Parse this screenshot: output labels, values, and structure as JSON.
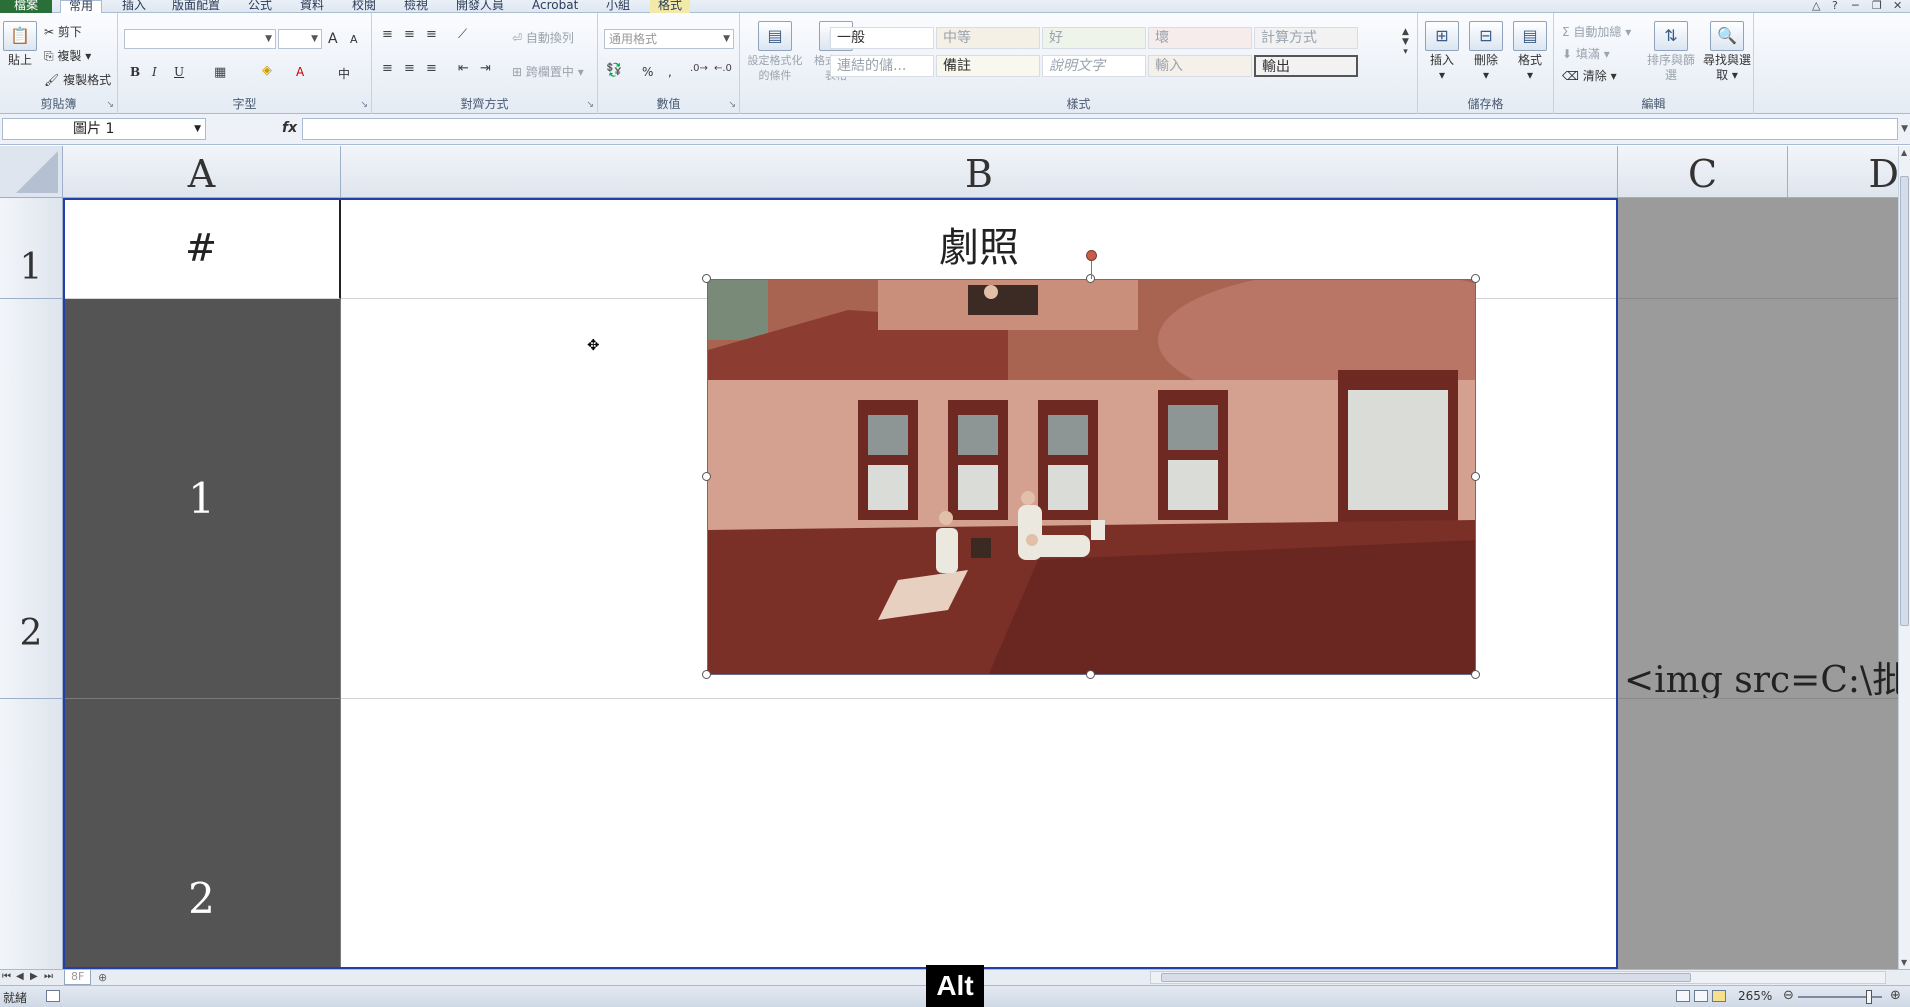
{
  "ribbon_tabs": [
    "檔案",
    "常用",
    "插入",
    "版面配置",
    "公式",
    "資料",
    "校閱",
    "檢視",
    "開發人員",
    "Acrobat",
    "小組",
    "格式"
  ],
  "clipboard": {
    "paste": "貼上",
    "cut": "剪下",
    "copy": "複製",
    "format_painter": "複製格式",
    "label": "剪貼簿"
  },
  "font": {
    "label": "字型",
    "bold": "B",
    "italic": "I",
    "underline": "U",
    "grow": "A",
    "shrink": "A",
    "color": "A",
    "phonetic": "中"
  },
  "alignment": {
    "label": "對齊方式",
    "wrap": "自動換列",
    "merge": "跨欄置中"
  },
  "number": {
    "label": "數值",
    "format": "通用格式",
    "percent": "%",
    "comma": ","
  },
  "styles": {
    "label": "樣式",
    "conditional": "設定格式化的條件",
    "as_table": "格式化為表格",
    "cells": [
      {
        "text": "一般",
        "bg": "#ffffff",
        "color": "#333333"
      },
      {
        "text": "中等",
        "bg": "#f5f0e6",
        "color": "#9aa3ae"
      },
      {
        "text": "好",
        "bg": "#eef4ea",
        "color": "#9aa3ae"
      },
      {
        "text": "壞",
        "bg": "#f6eceb",
        "color": "#9aa3ae"
      },
      {
        "text": "計算方式",
        "bg": "#f2f2f2",
        "color": "#9aa3ae"
      },
      {
        "text": "連結的儲...",
        "bg": "#ffffff",
        "color": "#9aa3ae"
      },
      {
        "text": "備註",
        "bg": "#f8f8ee",
        "color": "#333333"
      },
      {
        "text": "說明文字",
        "bg": "#ffffff",
        "color": "#9aa3ae"
      },
      {
        "text": "輸入",
        "bg": "#f5f0ea",
        "color": "#9aa3ae"
      },
      {
        "text": "輸出",
        "bg": "#f2f2f2",
        "color": "#333333"
      }
    ]
  },
  "cells_group": {
    "label": "儲存格",
    "insert": "插入",
    "delete": "刪除",
    "format": "格式"
  },
  "editing": {
    "label": "編輯",
    "autosum": "自動加總",
    "fill": "填滿",
    "clear": "清除",
    "sort": "排序與篩選",
    "find": "尋找與選取"
  },
  "name_box": "圖片 1",
  "fx": "fx",
  "columns": [
    "A",
    "B",
    "C",
    "D"
  ],
  "rows": [
    "1",
    "2"
  ],
  "cells": {
    "a1": "#",
    "b1": "劇照",
    "a2": "1",
    "c2": "<img src=C:\\批量",
    "a3": "2"
  },
  "sheet_tab": "8F",
  "status": {
    "ready": "就緒",
    "zoom": "265%"
  },
  "key_overlay": "Alt",
  "colors": {
    "selection": "#2340a8",
    "dark_cell": "#545454",
    "grey_column": "#9b9b9b",
    "file_tab": "#2a6f37"
  }
}
